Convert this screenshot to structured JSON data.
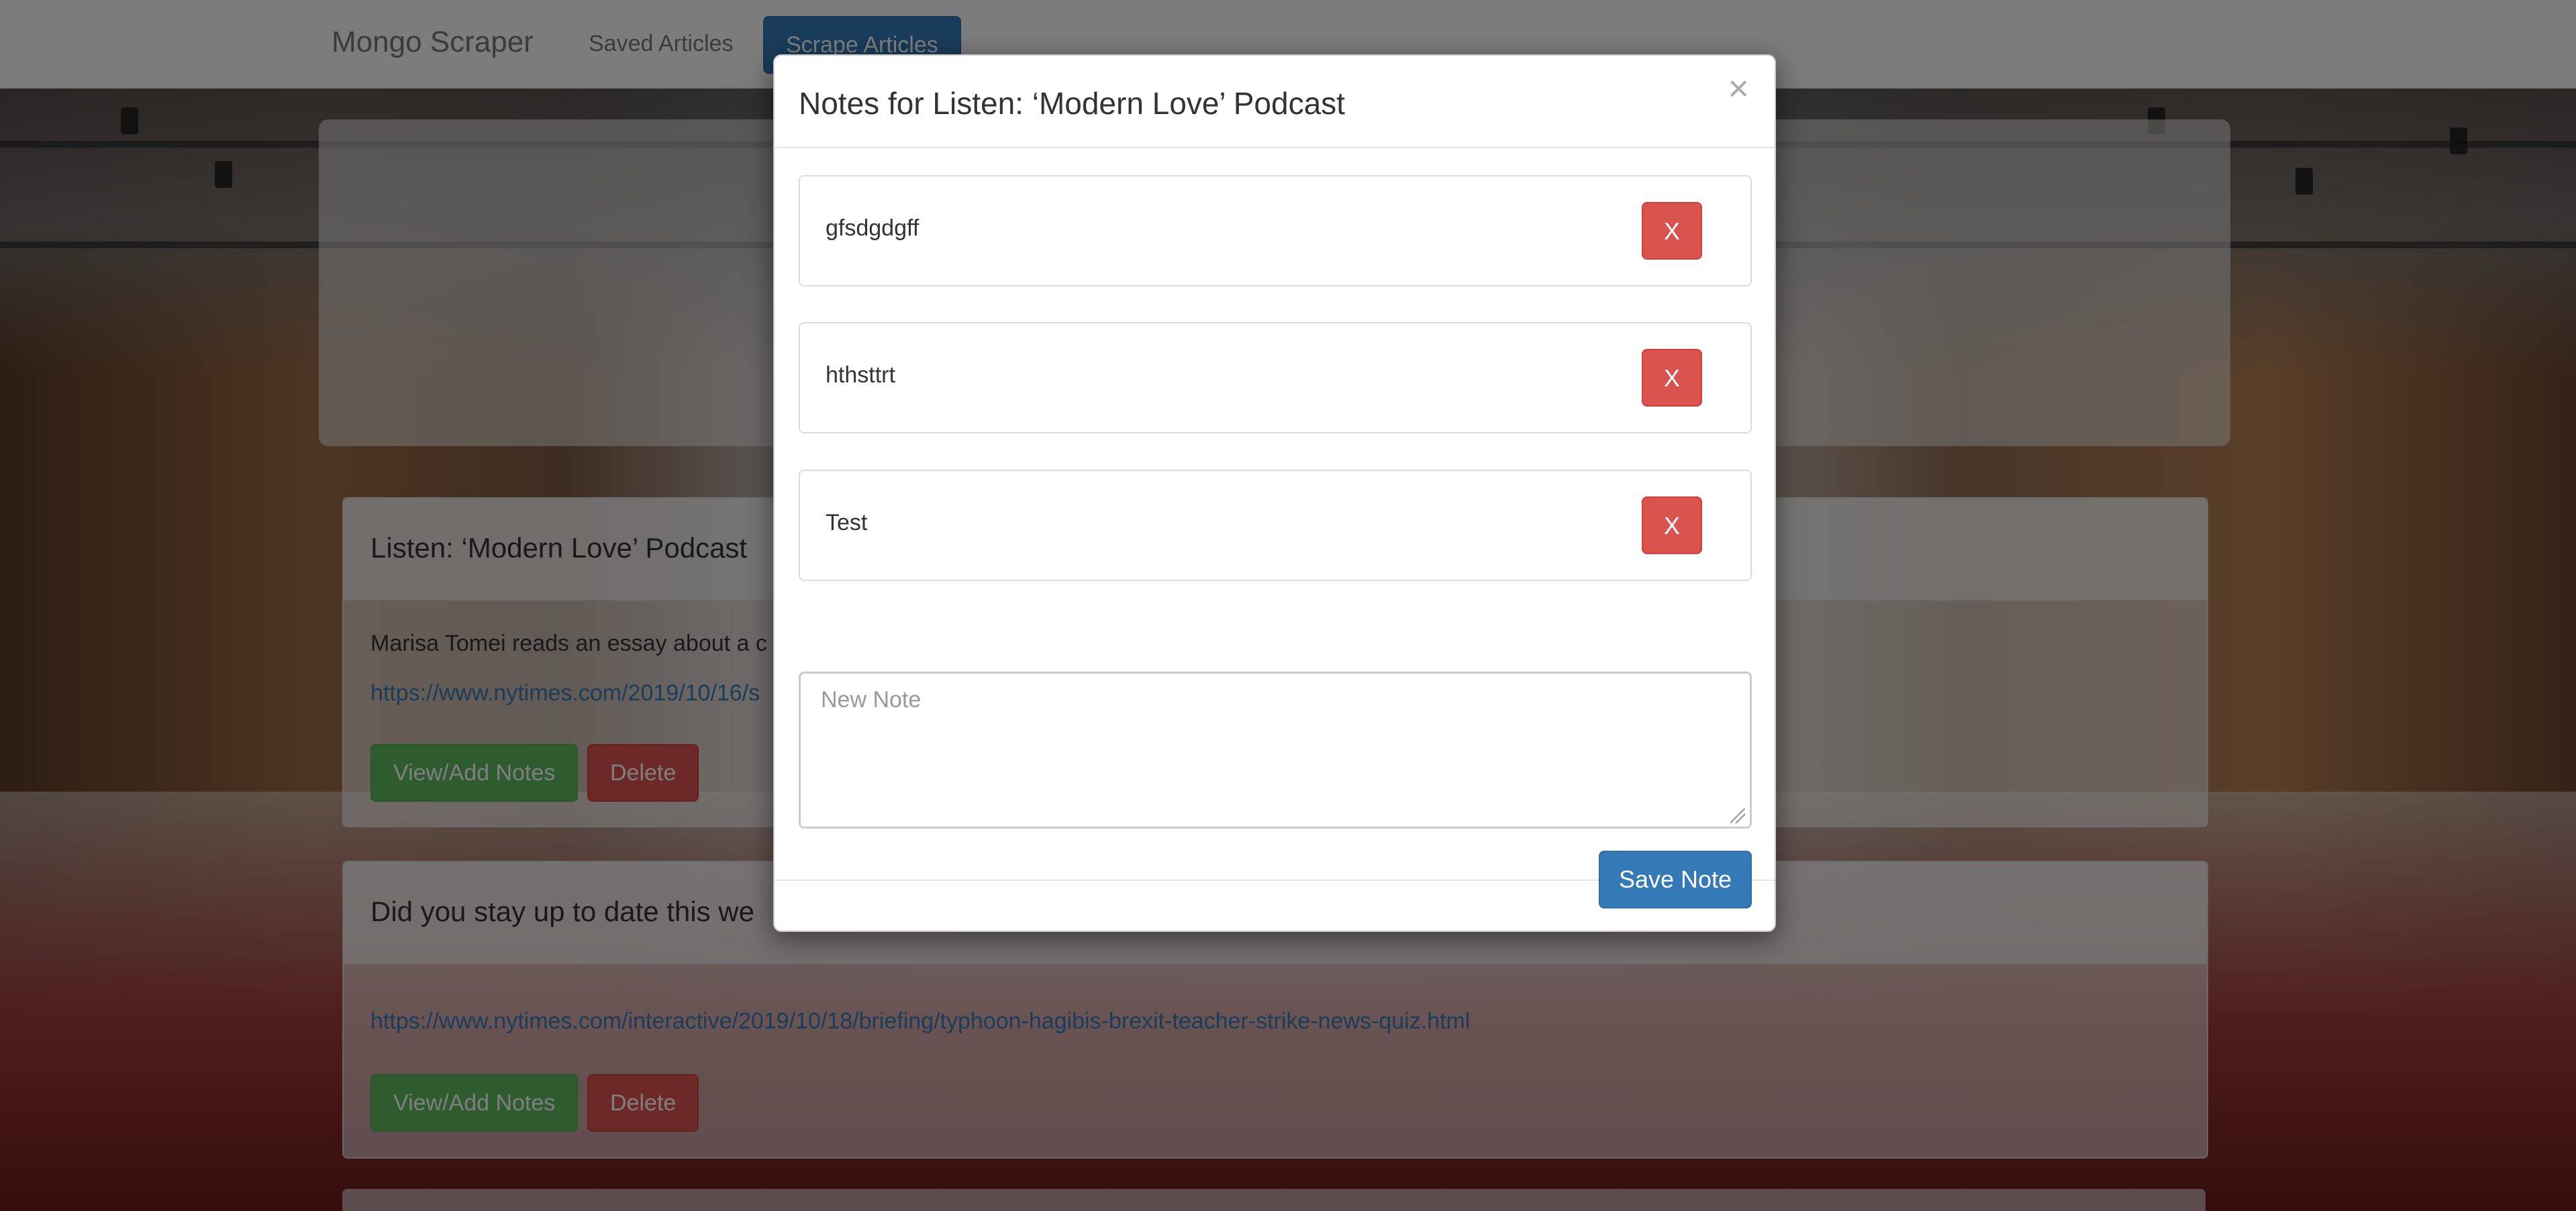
{
  "navbar": {
    "brand": "Mongo Scraper",
    "links": [
      {
        "label": "Saved Articles"
      },
      {
        "label": "Scrape Articles"
      }
    ]
  },
  "articles": [
    {
      "title": "Listen: ‘Modern Love’ Podcast",
      "summary": "Marisa Tomei reads an essay about a c",
      "link": "https://www.nytimes.com/2019/10/16/s",
      "notes_label": "View/Add Notes",
      "delete_label": "Delete"
    },
    {
      "title": "Did you stay up to date this we",
      "link": "https://www.nytimes.com/interactive/2019/10/18/briefing/typhoon-hagibis-brexit-teacher-strike-news-quiz.html",
      "notes_label": "View/Add Notes",
      "delete_label": "Delete"
    }
  ],
  "modal": {
    "title": "Notes for Listen: ‘Modern Love’ Podcast",
    "close_label": "×",
    "notes": [
      {
        "text": "gfsdgdgff",
        "delete_label": "X"
      },
      {
        "text": "hthsttrt",
        "delete_label": "X"
      },
      {
        "text": "Test",
        "delete_label": "X"
      }
    ],
    "new_note_placeholder": "New Note",
    "save_label": "Save Note"
  },
  "colors": {
    "primary": "#337ab7",
    "success": "#5cb85c",
    "danger": "#d9534f"
  }
}
